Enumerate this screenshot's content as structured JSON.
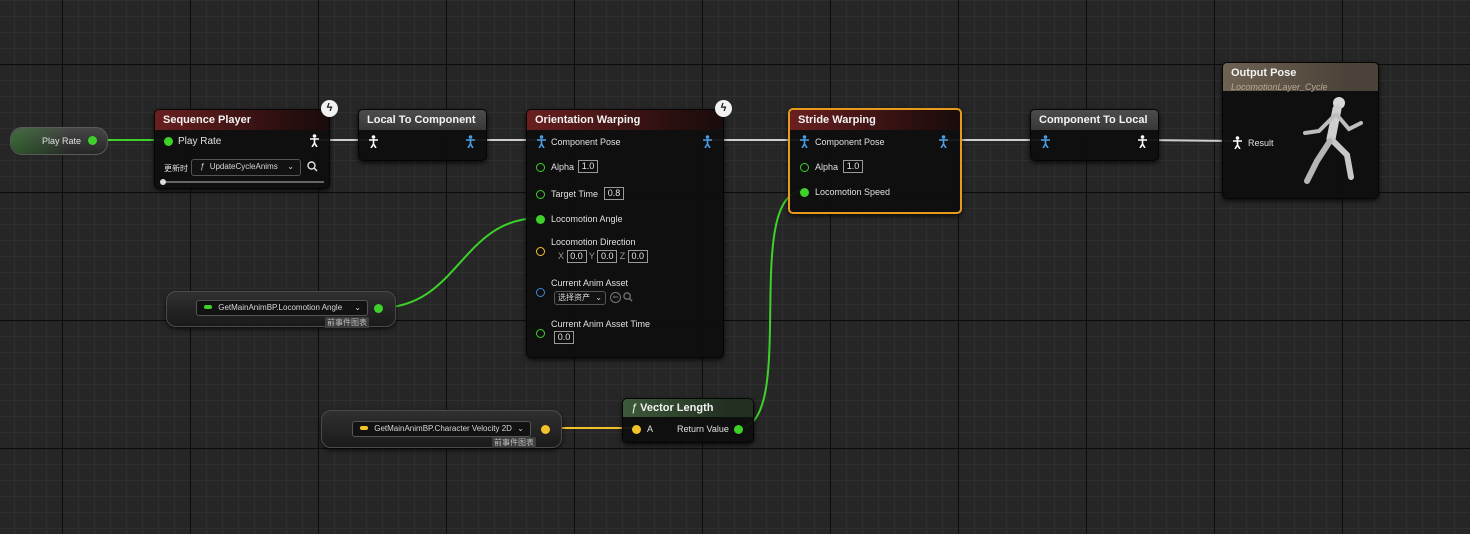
{
  "play_rate_node": {
    "label": "Play Rate"
  },
  "sequence_player": {
    "title": "Sequence Player",
    "pin_play_rate": "Play Rate",
    "update_label": "更新时",
    "function_name": "UpdateCycleAnims"
  },
  "local_to_component": {
    "title": "Local To Component"
  },
  "orientation_warping": {
    "title": "Orientation Warping",
    "component_pose": "Component Pose",
    "alpha_label": "Alpha",
    "alpha_value": "1.0",
    "target_time_label": "Target Time",
    "target_time_value": "0.8",
    "locomotion_angle": "Locomotion Angle",
    "locomotion_direction": "Locomotion Direction",
    "dir_x_label": "X",
    "dir_x": "0.0",
    "dir_y_label": "Y",
    "dir_y": "0.0",
    "dir_z_label": "Z",
    "dir_z": "0.0",
    "current_anim_asset": "Current Anim Asset",
    "select_asset": "选择资产",
    "current_anim_asset_time": "Current Anim Asset Time",
    "asset_time_value": "0.0"
  },
  "stride_warping": {
    "title": "Stride Warping",
    "component_pose": "Component Pose",
    "alpha_label": "Alpha",
    "alpha_value": "1.0",
    "locomotion_speed": "Locomotion Speed"
  },
  "component_to_local": {
    "title": "Component To Local"
  },
  "output_pose": {
    "title": "Output Pose",
    "subtitle": "LocomotionLayer_Cycle",
    "result": "Result"
  },
  "angle_getter": {
    "label": "GetMainAnimBP.Locomotion Angle",
    "tag": "前事件图表"
  },
  "velocity_getter": {
    "label": "GetMainAnimBP.Character Velocity 2D",
    "tag": "前事件图表"
  },
  "vector_length": {
    "title": "Vector Length",
    "pin_a": "A",
    "return_value": "Return Value"
  },
  "colors": {
    "float_pin": "#3dd12a",
    "vector_pin": "#f2c228",
    "object_pin": "#3a8ad8",
    "selection": "#e89a1c",
    "pose_wire": "#cfcfcf"
  },
  "icons": [
    "lightning-icon",
    "pose-icon",
    "function-icon",
    "dropdown-icon",
    "search-icon",
    "mannequin-icon"
  ]
}
